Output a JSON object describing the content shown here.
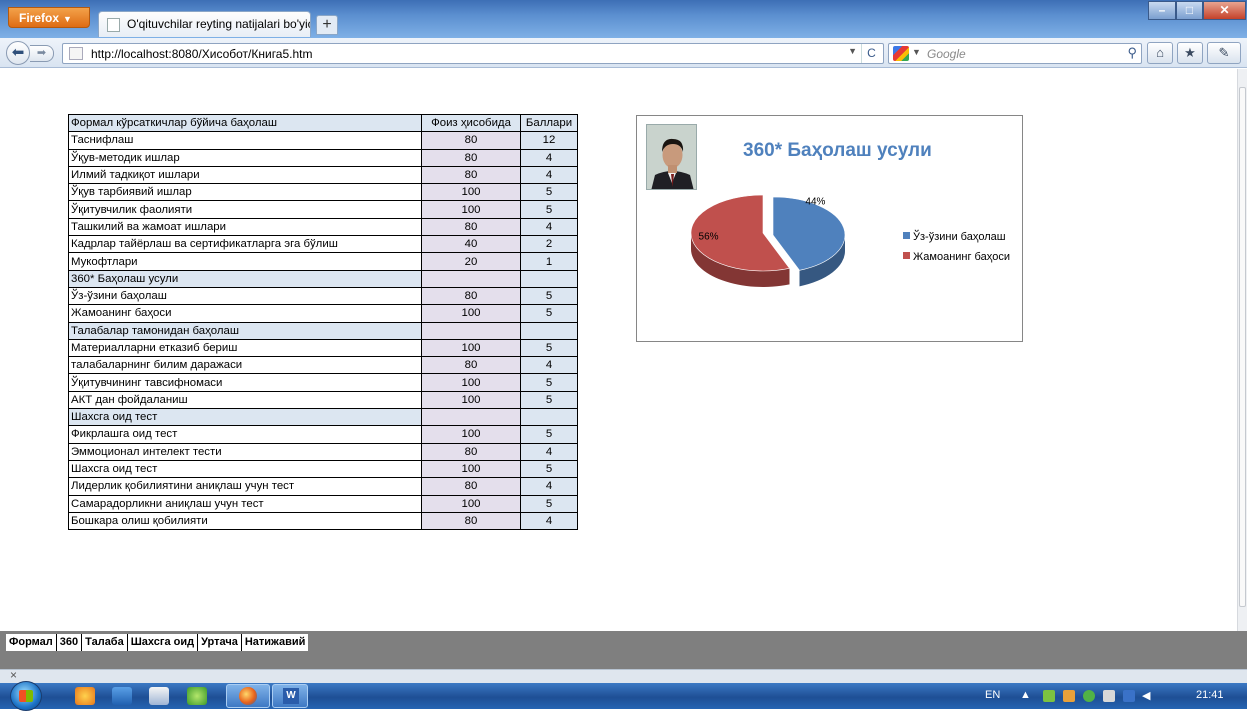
{
  "browser": {
    "menu_button": "Firefox",
    "tab_title": "O'qituvchilar reyting natijalari bo'yicha h...",
    "url": "http://localhost:8080/Хисобот/Книга5.htm",
    "search_placeholder": "Google"
  },
  "table": {
    "header": {
      "label": "Формал кўрсаткичлар бўйича баҳолаш",
      "col_percent": "Фоиз ҳисобида",
      "col_score": "Баллари"
    },
    "rows": [
      {
        "label": "Таснифлаш",
        "percent": "80",
        "score": "12"
      },
      {
        "label": "Ўқув-методик ишлар",
        "percent": "80",
        "score": "4"
      },
      {
        "label": "Илмий тадкиқот ишлари",
        "percent": "80",
        "score": "4"
      },
      {
        "label": "Ўқув тарбиявий ишлар",
        "percent": "100",
        "score": "5"
      },
      {
        "label": "Ўқитувчилик фаолияти",
        "percent": "100",
        "score": "5"
      },
      {
        "label": "Ташкилий ва жамоат ишлари",
        "percent": "80",
        "score": "4"
      },
      {
        "label": "Кадрлар тайёрлаш ва сертификатларга эга бўлиш",
        "percent": "40",
        "score": "2"
      },
      {
        "label": "Мукофтлари",
        "percent": "20",
        "score": "1"
      },
      {
        "label": "360* Баҳолаш усули",
        "section": true
      },
      {
        "label": "Ўз-ўзини баҳолаш",
        "percent": "80",
        "score": "5"
      },
      {
        "label": "Жамоанинг баҳоси",
        "percent": "100",
        "score": "5"
      },
      {
        "label": "Талабалар тамонидан баҳолаш",
        "section": true
      },
      {
        "label": "Материалларни етказиб бериш",
        "percent": "100",
        "score": "5"
      },
      {
        "label": " талабаларнинг билим даражаси",
        "percent": "80",
        "score": "4"
      },
      {
        "label": "Ўқитувчининг тавсифномаси",
        "percent": "100",
        "score": "5"
      },
      {
        "label": "АКТ дан фойдаланиш",
        "percent": "100",
        "score": "5"
      },
      {
        "label": "Шахсга оид тест",
        "section": true
      },
      {
        "label": "Фикрлашга оид  тест",
        "percent": "100",
        "score": "5"
      },
      {
        "label": "Эммоционал интелект тести",
        "percent": "80",
        "score": "4"
      },
      {
        "label": "Шахсга оид тест",
        "percent": "100",
        "score": "5"
      },
      {
        "label": "Лидерлик қобилиятини аниқлаш учун тест",
        "percent": "80",
        "score": "4"
      },
      {
        "label": "Самарадорликни аниқлаш учун тест",
        "percent": "100",
        "score": "5"
      },
      {
        "label": "Бошкара олиш қобилияти",
        "percent": "80",
        "score": "4"
      }
    ]
  },
  "chart_data": {
    "type": "pie",
    "title": "360* Баҳолаш усули",
    "categories": [
      "Ўз-ўзини баҳолаш",
      "Жамоанинг баҳоси"
    ],
    "values": [
      44,
      56
    ],
    "labels": [
      "44%",
      "56%"
    ],
    "colors": [
      "#4f81bd",
      "#c0504d"
    ],
    "legend": "right"
  },
  "sheet_tabs": [
    "Формал",
    "360",
    "Талаба",
    "Шахсга оид",
    "Уртача",
    "Натижавий"
  ],
  "taskbar": {
    "lang": "EN",
    "clock": "21:41"
  }
}
